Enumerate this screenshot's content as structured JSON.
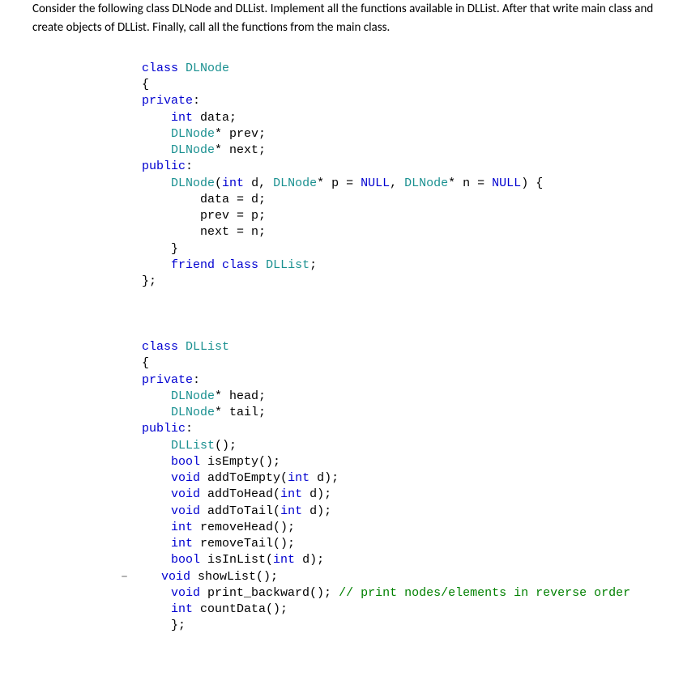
{
  "prose": {
    "p1": "Consider the following class DLNode and DLList. Implement all the functions available in DLList. After that write main class and create objects of DLList. Finally, call all the functions from the main class."
  },
  "kw": {
    "class": "class",
    "private": "private",
    "public": "public",
    "int": "int",
    "bool": "bool",
    "void": "void",
    "friend": "friend",
    "NULL": "NULL"
  },
  "type": {
    "DLNode": "DLNode",
    "DLList": "DLList"
  },
  "dlnode": {
    "field_data": " data;",
    "field_prev": "* prev;",
    "field_next": "* next;",
    "ctor_sig_1": "(",
    "ctor_sig_d": " d, ",
    "ctor_sig_p": "* p = ",
    "ctor_sig_comma": ", ",
    "ctor_sig_n": "* n = ",
    "ctor_sig_end": ") {",
    "body_data": "data = d;",
    "body_prev": "prev = p;",
    "body_next": "next = n;",
    "close_brace": "}",
    "friend_tail": ";",
    "end": "};"
  },
  "dllist": {
    "field_head": "* head;",
    "field_tail": "* tail;",
    "ctor": "();",
    "isEmpty": " isEmpty();",
    "addToEmpty_1": " addToEmpty(",
    "addToEmpty_2": " d);",
    "addToHead_1": " addToHead(",
    "addToHead_2": " d);",
    "addToTail_1": " addToTail(",
    "addToTail_2": " d);",
    "removeHead": " removeHead();",
    "removeTail": " removeTail();",
    "isInList_1": " isInList(",
    "isInList_2": " d);",
    "showList": " showList();",
    "print_back": " print_backward(); ",
    "print_back_cmt": "// print nodes/elements in reverse order",
    "countData": " countData();",
    "end": "};"
  },
  "open_brace": "{",
  "colon": ":",
  "gutter_minus": "–"
}
